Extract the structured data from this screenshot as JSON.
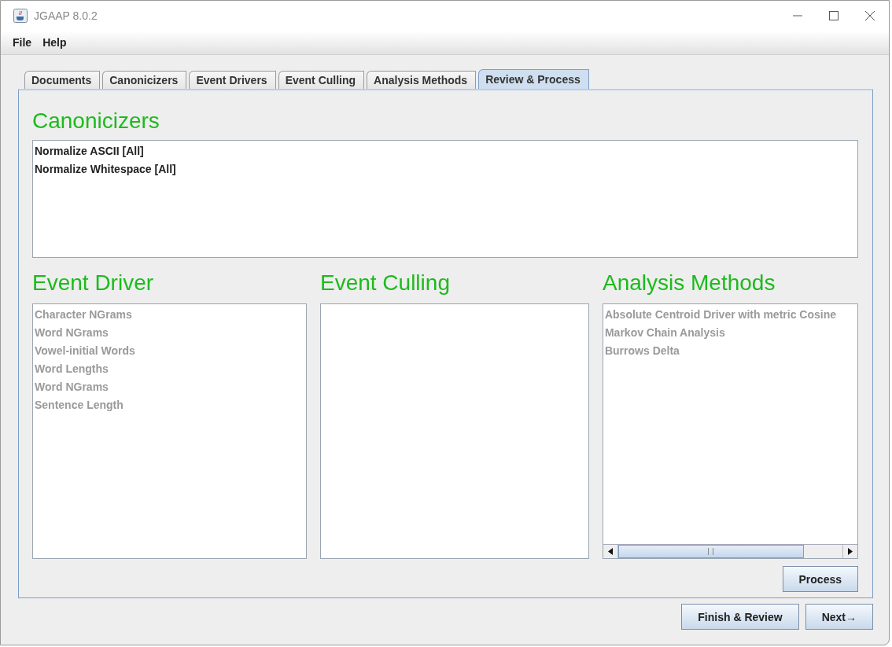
{
  "window": {
    "title": "JGAAP 8.0.2"
  },
  "menu": [
    "File",
    "Help"
  ],
  "tabs": [
    {
      "label": "Documents",
      "selected": false
    },
    {
      "label": "Canonicizers",
      "selected": false
    },
    {
      "label": "Event Drivers",
      "selected": false
    },
    {
      "label": "Event Culling",
      "selected": false
    },
    {
      "label": "Analysis Methods",
      "selected": false
    },
    {
      "label": "Review & Process",
      "selected": true
    }
  ],
  "canonicizers": {
    "title": "Canonicizers",
    "items": [
      {
        "label": "Normalize ASCII [All]",
        "disabled": false
      },
      {
        "label": "Normalize Whitespace [All]",
        "disabled": false
      }
    ]
  },
  "columns": [
    {
      "title": "Event Driver",
      "items": [
        {
          "label": "Character NGrams",
          "disabled": true
        },
        {
          "label": "Word NGrams",
          "disabled": true
        },
        {
          "label": "Vowel-initial Words",
          "disabled": true
        },
        {
          "label": "Word Lengths",
          "disabled": true
        },
        {
          "label": "Word NGrams",
          "disabled": true
        },
        {
          "label": "Sentence Length",
          "disabled": true
        }
      ]
    },
    {
      "title": "Event Culling"
    },
    {
      "title": "Analysis Methods",
      "scrollbar": true,
      "items": [
        {
          "label": "Absolute Centroid Driver with metric Cosine",
          "disabled": true
        },
        {
          "label": "Markov Chain Analysis",
          "disabled": true
        },
        {
          "label": "Burrows Delta",
          "disabled": true
        }
      ]
    }
  ],
  "process_button": "Process",
  "buttons": [
    "Finish & Review",
    "Next→"
  ]
}
